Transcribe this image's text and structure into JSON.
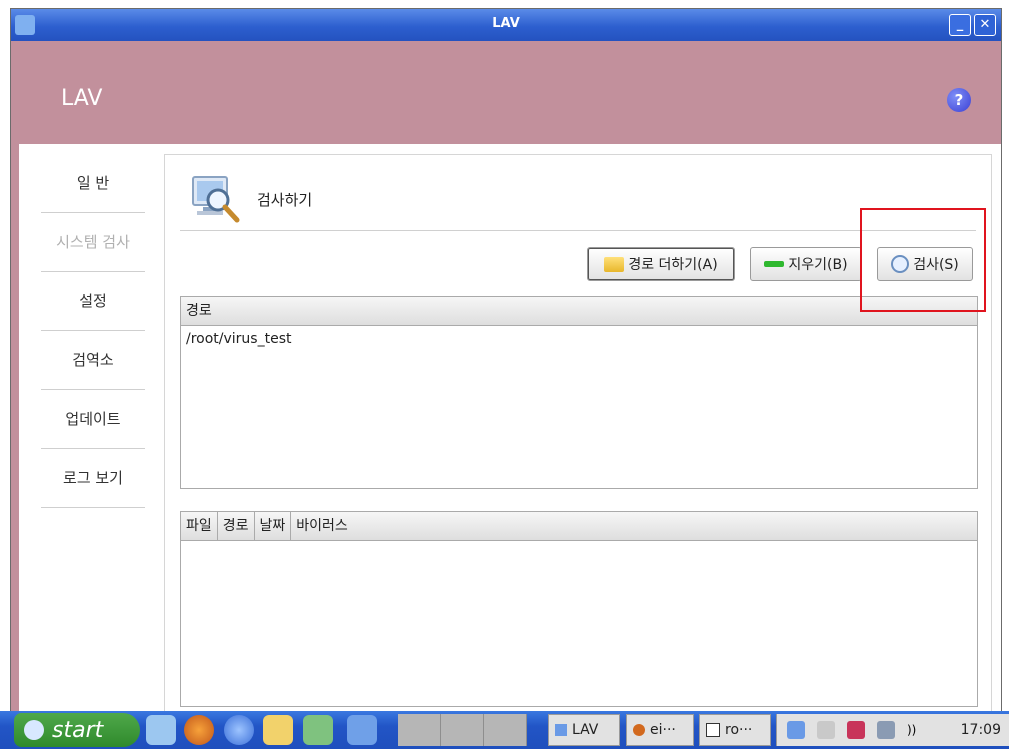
{
  "window": {
    "title": "LAV"
  },
  "header": {
    "app_name": "LAV",
    "help_label": "?"
  },
  "sidebar": {
    "items": [
      {
        "label": "일 반"
      },
      {
        "label": "시스템 검사"
      },
      {
        "label": "설정"
      },
      {
        "label": "검역소"
      },
      {
        "label": "업데이트"
      },
      {
        "label": "로그 보기"
      }
    ]
  },
  "panel": {
    "title": "검사하기",
    "buttons": {
      "add_path": "경로 더하기(A)",
      "clear": "지우기(B)",
      "scan": "검사(S)"
    },
    "path_table": {
      "header": "경로",
      "rows": [
        "/root/virus_test"
      ]
    },
    "results_table": {
      "headers": [
        "파일",
        "경로",
        "날짜",
        "바이러스"
      ]
    }
  },
  "taskbar": {
    "start_label": "start",
    "tasks": [
      "LAV",
      "ei···",
      "ro···"
    ],
    "clock": "17:09",
    "volume_label": "))"
  }
}
